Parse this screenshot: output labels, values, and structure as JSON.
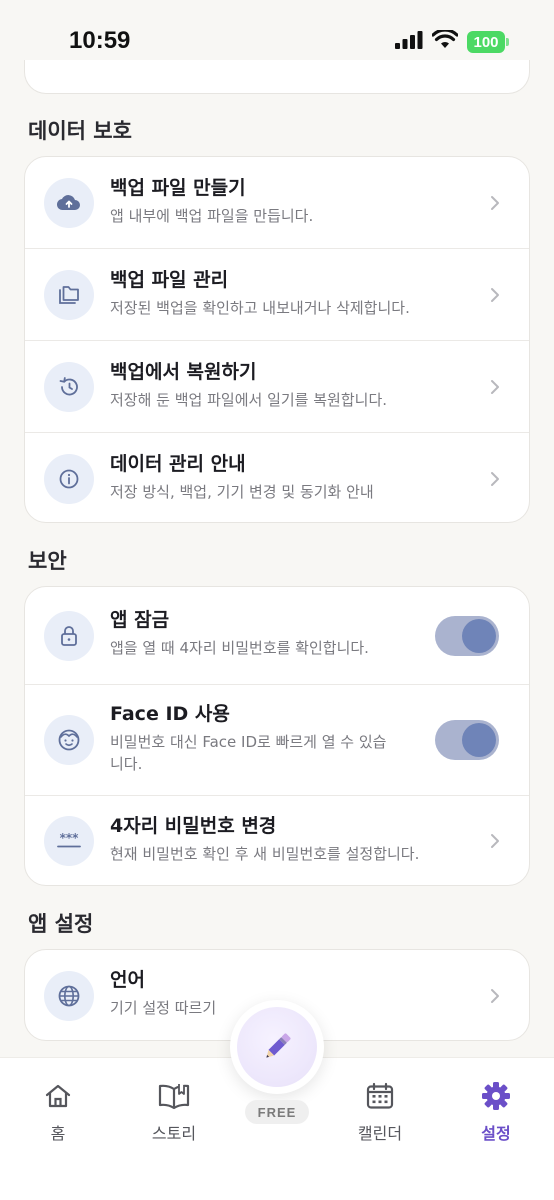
{
  "status_bar": {
    "time": "10:59",
    "battery": "100"
  },
  "sections": {
    "data_protection": {
      "title": "데이터 보호",
      "rows": [
        {
          "title": "백업 파일 만들기",
          "subtitle": "앱 내부에 백업 파일을 만듭니다.",
          "icon": "cloud-upload-icon"
        },
        {
          "title": "백업 파일 관리",
          "subtitle": "저장된 백업을 확인하고 내보내거나 삭제합니다.",
          "icon": "folders-icon"
        },
        {
          "title": "백업에서 복원하기",
          "subtitle": "저장해 둔 백업 파일에서 일기를 복원합니다.",
          "icon": "history-icon"
        },
        {
          "title": "데이터 관리 안내",
          "subtitle": "저장 방식, 백업, 기기 변경 및 동기화 안내",
          "icon": "info-icon"
        }
      ]
    },
    "security": {
      "title": "보안",
      "rows": [
        {
          "title": "앱 잠금",
          "subtitle": "앱을 열 때 4자리 비밀번호를 확인합니다.",
          "icon": "lock-icon",
          "toggle_on": true
        },
        {
          "title": "Face ID 사용",
          "subtitle": "비밀번호 대신 Face ID로 빠르게 열 수 있습니다.",
          "icon": "face-icon",
          "toggle_on": true
        },
        {
          "title": "4자리 비밀번호 변경",
          "subtitle": "현재 비밀번호 확인 후 새 비밀번호를 설정합니다.",
          "icon": "password-icon"
        }
      ]
    },
    "app_settings": {
      "title": "앱 설정",
      "rows": [
        {
          "title": "언어",
          "subtitle": "기기 설정 따르기",
          "icon": "globe-icon"
        }
      ]
    }
  },
  "tab_bar": {
    "tabs": [
      {
        "label": "홈",
        "icon": "home-icon"
      },
      {
        "label": "스토리",
        "icon": "book-icon"
      },
      {
        "label": "캘린더",
        "icon": "calendar-icon"
      },
      {
        "label": "설정",
        "icon": "gear-icon",
        "active": true
      }
    ],
    "fab_icon": "pencil-icon",
    "free_badge": "FREE"
  },
  "colors": {
    "accent": "#6b4fc8",
    "icon_blue": "#5f6f9a",
    "toggle_track": "#aab3cf",
    "toggle_knob": "#6f84b8"
  }
}
